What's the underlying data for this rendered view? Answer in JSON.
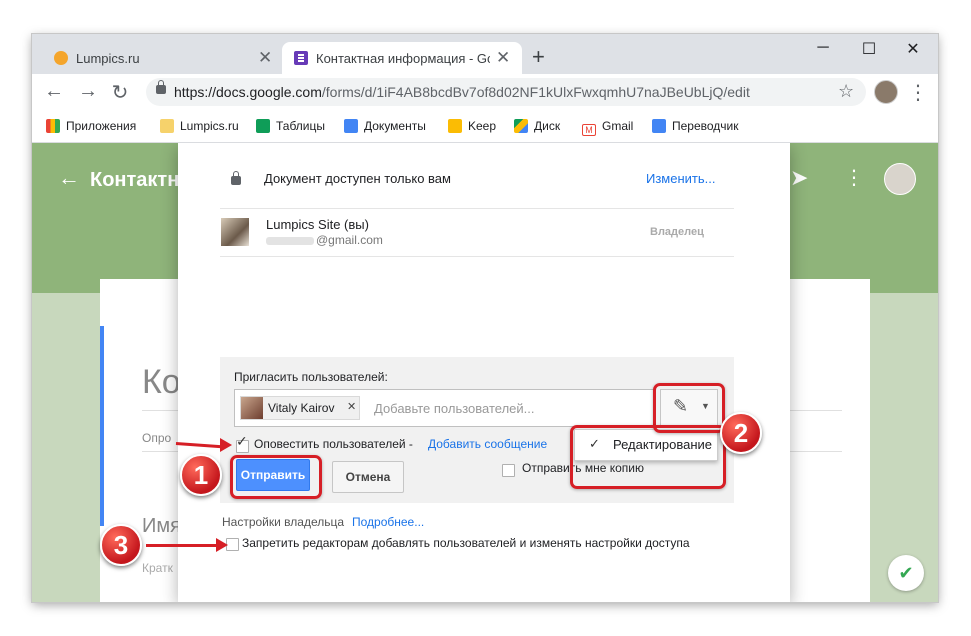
{
  "browser": {
    "tabs": [
      {
        "title": "Lumpics.ru",
        "active": false
      },
      {
        "title": "Контактная информация - Goog",
        "active": true
      }
    ],
    "url_host": "https://docs.google.com",
    "url_path": "/forms/d/1iF4AB8bcdBv7of8d02NF1kUlxFwxqmhU7naJBeUbLjQ/edit",
    "bookmarks": [
      "Приложения",
      "Lumpics.ru",
      "Таблицы",
      "Документы",
      "Keep",
      "Диск",
      "Gmail",
      "Переводчик"
    ],
    "colors": {
      "tabstrip": "#dee1e6",
      "omnibox": "#f1f3f4"
    }
  },
  "forms": {
    "header_title": "Контактн",
    "card_title": "Ко",
    "card_desc": "Опро",
    "question_title": "Имя",
    "question_hint": "Кратк",
    "colors": {
      "header": "#8fb47a",
      "background": "#c8d8bd",
      "accent": "#4285f4"
    }
  },
  "dialog": {
    "access_text": "Документ доступен только вам",
    "change_link": "Изменить...",
    "owner": {
      "name": "Lumpics Site (вы)",
      "email": "@gmail.com",
      "role": "Владелец"
    },
    "invite_label": "Пригласить пользователей:",
    "chip_name": "Vitaly Kairov",
    "add_placeholder": "Добавьте пользователей...",
    "notify_label": "Оповестить пользователей -",
    "add_message_link": "Добавить сообщение",
    "send_copy_label": "Отправить мне копию",
    "send_button": "Отправить",
    "cancel_button": "Отмена",
    "owner_settings": "Настройки владельца",
    "more_link": "Подробнее...",
    "prevent_editors_label": "Запретить редакторам добавлять пользователей и изменять настройки доступа",
    "permission_menu": {
      "selected": "Редактирование"
    },
    "notify_checked": true,
    "send_copy_checked": false,
    "prevent_checked": false,
    "colors": {
      "primary_button": "#4d90fe",
      "link": "#1a73e8"
    }
  },
  "annotations": {
    "badges": [
      "1",
      "2",
      "3"
    ],
    "color": "#d61f26"
  }
}
